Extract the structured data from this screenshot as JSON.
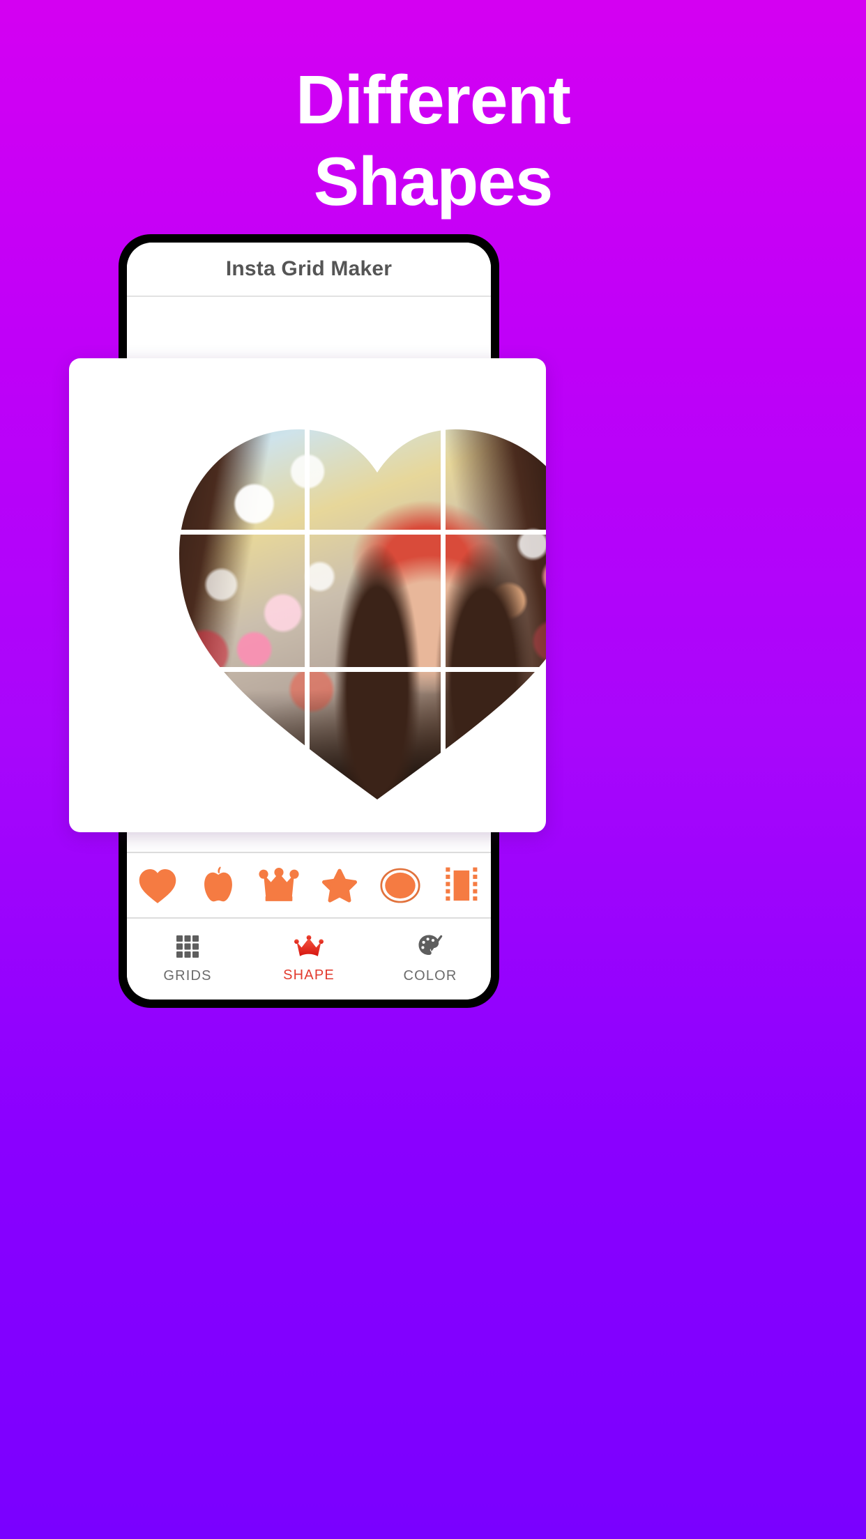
{
  "promo": {
    "line1": "Different",
    "line2": "Shapes",
    "text_color": "#FFFFFF",
    "background_top": "#D400F2",
    "background_bottom": "#7A00FF"
  },
  "app": {
    "title": "Insta Grid Maker",
    "title_color": "#555555"
  },
  "preview": {
    "shape": "heart",
    "grid_rows": 3,
    "grid_columns": 3,
    "grid_line_color": "#FFFFFF",
    "photo_description": "Smiling young woman with red bandana, blurred city bokeh background"
  },
  "shape_toolbar": {
    "accent_color": "#F57B42",
    "selected": "heart",
    "items": [
      {
        "id": "heart",
        "icon": "heart-shape-icon"
      },
      {
        "id": "apple",
        "icon": "apple-shape-icon"
      },
      {
        "id": "crown",
        "icon": "crown-shape-icon"
      },
      {
        "id": "star",
        "icon": "star-shape-icon"
      },
      {
        "id": "oval",
        "icon": "oval-shape-icon"
      },
      {
        "id": "film",
        "icon": "film-strip-shape-icon"
      }
    ]
  },
  "bottom_nav": {
    "active": "SHAPE",
    "active_color": "#E23B2E",
    "inactive_color": "#6B6B6B",
    "items": [
      {
        "label": "GRIDS",
        "icon": "grid-icon",
        "active": false
      },
      {
        "label": "SHAPE",
        "icon": "crown-icon",
        "active": true
      },
      {
        "label": "COLOR",
        "icon": "palette-icon",
        "active": false
      }
    ]
  }
}
